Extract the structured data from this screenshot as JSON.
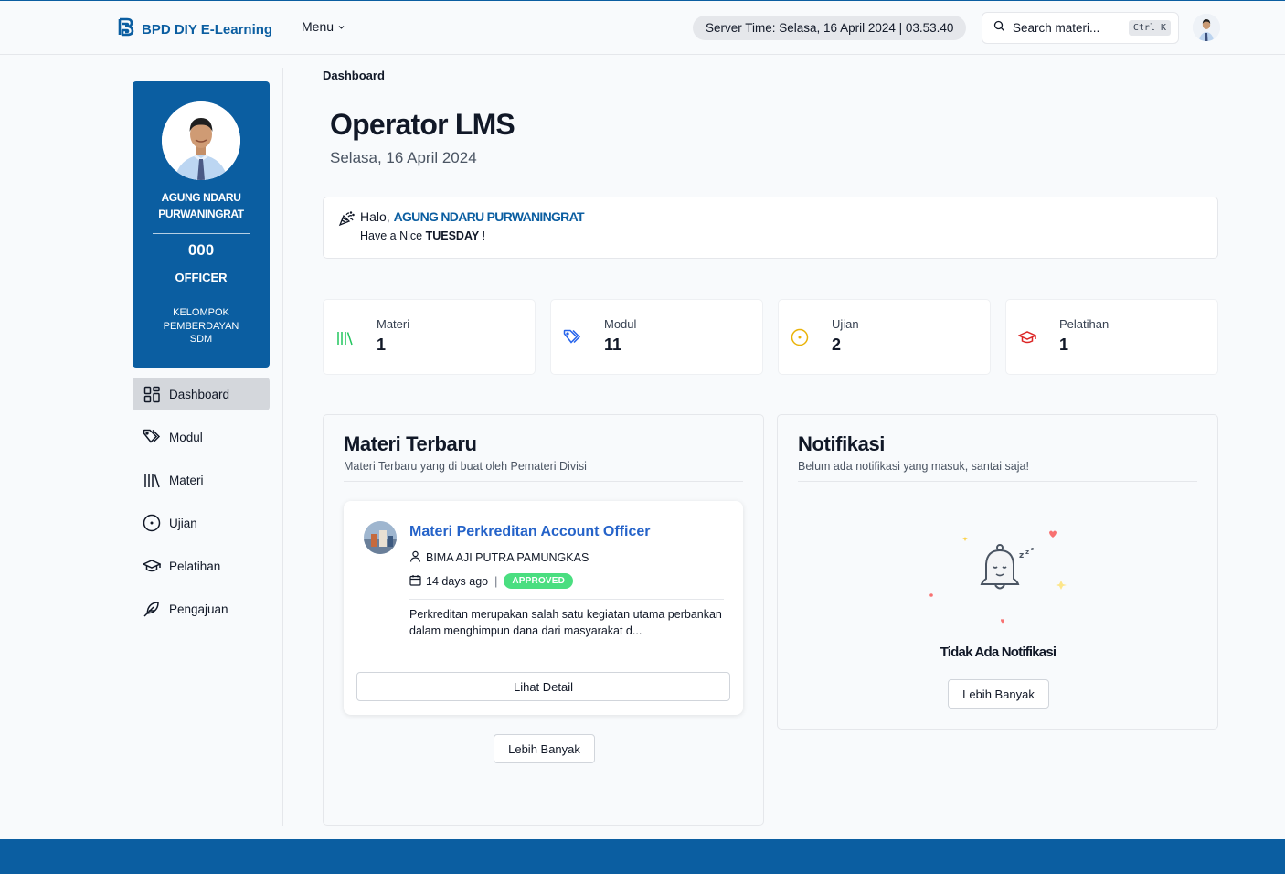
{
  "header": {
    "brand": "BPD DIY E-Learning",
    "menu_label": "Menu",
    "server_time": "Server Time: Selasa, 16 April 2024 | 03.53.40",
    "search_placeholder": "Search materi...",
    "search_shortcut": "Ctrl K"
  },
  "profile": {
    "name": "AGUNG NDARU PURWANINGRAT",
    "number": "000",
    "role": "OFFICER",
    "group": "KELOMPOK PEMBERDAYAN SDM"
  },
  "sidebar": {
    "items": [
      {
        "label": "Dashboard",
        "icon": "dashboard-icon",
        "active": true
      },
      {
        "label": "Modul",
        "icon": "tags-icon",
        "active": false
      },
      {
        "label": "Materi",
        "icon": "library-icon",
        "active": false
      },
      {
        "label": "Ujian",
        "icon": "circle-dot-icon",
        "active": false
      },
      {
        "label": "Pelatihan",
        "icon": "graduation-cap-icon",
        "active": false
      },
      {
        "label": "Pengajuan",
        "icon": "feather-icon",
        "active": false
      }
    ]
  },
  "main": {
    "breadcrumb": "Dashboard",
    "title": "Operator LMS",
    "date": "Selasa, 16 April 2024",
    "greeting": {
      "hello": "Halo,",
      "name": "AGUNG NDARU PURWANINGRAT",
      "line2_prefix": "Have a Nice",
      "day": "TUESDAY",
      "line2_suffix": "!"
    },
    "stats": [
      {
        "label": "Materi",
        "value": "1",
        "icon": "library-icon",
        "color": "#22c55e"
      },
      {
        "label": "Modul",
        "value": "11",
        "icon": "tags-icon",
        "color": "#2563eb"
      },
      {
        "label": "Ujian",
        "value": "2",
        "icon": "circle-dot-icon",
        "color": "#eab308"
      },
      {
        "label": "Pelatihan",
        "value": "1",
        "icon": "graduation-cap-icon",
        "color": "#dc2626"
      }
    ],
    "materi_panel": {
      "title": "Materi Terbaru",
      "subtitle": "Materi Terbaru yang di buat oleh Pemateri Divisi",
      "card": {
        "title": "Materi Perkreditan Account Officer",
        "author": "BIMA AJI PUTRA PAMUNGKAS",
        "time": "14 days ago",
        "status": "APPROVED",
        "description": "Perkreditan merupakan salah satu kegiatan utama perbankan dalam menghimpun dana dari masyarakat d...",
        "button": "Lihat Detail"
      },
      "more_button": "Lebih Banyak"
    },
    "notif_panel": {
      "title": "Notifikasi",
      "subtitle": "Belum ada notifikasi yang masuk, santai saja!",
      "empty_title": "Tidak Ada Notifikasi",
      "more_button": "Lebih Banyak"
    }
  },
  "colors": {
    "brand": "#0b5ea1",
    "link": "#2563c9",
    "approved": "#4ade80"
  }
}
